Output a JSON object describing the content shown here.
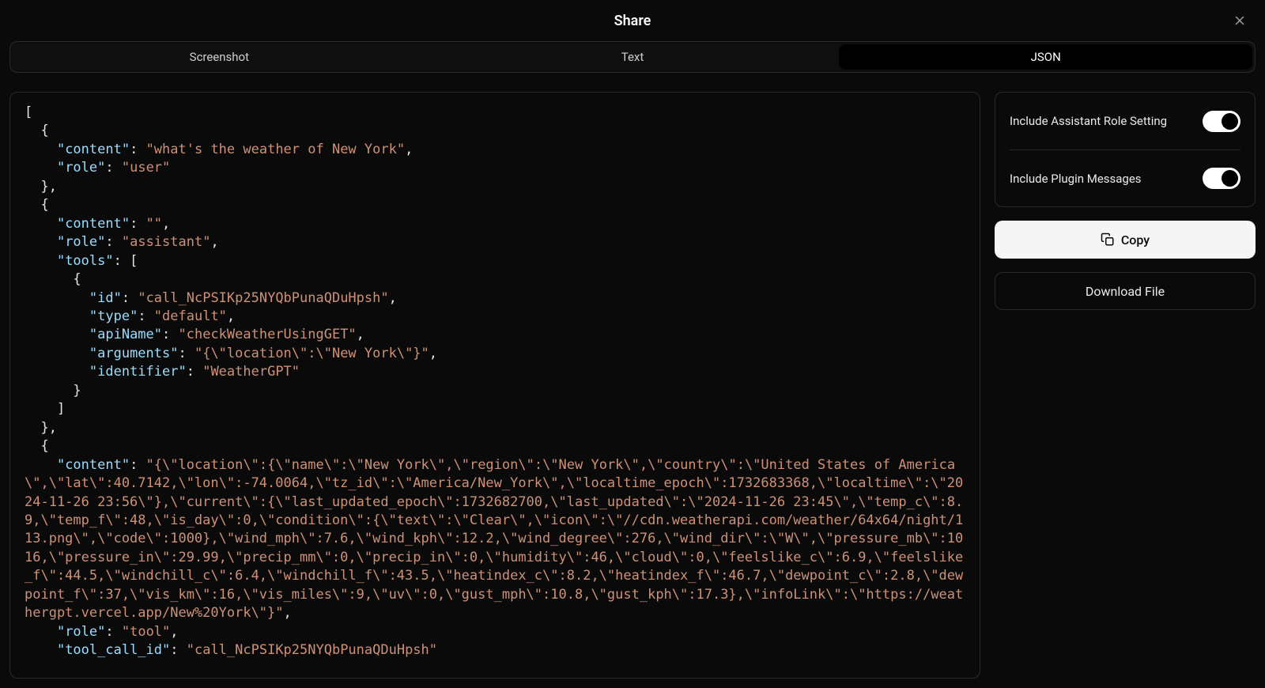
{
  "header": {
    "title": "Share"
  },
  "tabs": [
    {
      "label": "Screenshot",
      "active": false
    },
    {
      "label": "Text",
      "active": false
    },
    {
      "label": "JSON",
      "active": true
    }
  ],
  "options": {
    "assistantRole": {
      "label": "Include Assistant Role Setting",
      "value": true
    },
    "pluginMessages": {
      "label": "Include Plugin Messages",
      "value": true
    }
  },
  "actions": {
    "copy": "Copy",
    "download": "Download File"
  },
  "json_content": [
    {
      "type": "p",
      "text": "["
    },
    {
      "type": "p",
      "text": "  {"
    },
    {
      "type": "kv",
      "indent": "    ",
      "key": "content",
      "valType": "s",
      "val": "what's the weather of New York",
      "comma": true
    },
    {
      "type": "kv",
      "indent": "    ",
      "key": "role",
      "valType": "s",
      "val": "user",
      "comma": false
    },
    {
      "type": "p",
      "text": "  },"
    },
    {
      "type": "p",
      "text": "  {"
    },
    {
      "type": "kv",
      "indent": "    ",
      "key": "content",
      "valType": "s",
      "val": "",
      "comma": true
    },
    {
      "type": "kv",
      "indent": "    ",
      "key": "role",
      "valType": "s",
      "val": "assistant",
      "comma": true
    },
    {
      "type": "karr",
      "indent": "    ",
      "key": "tools"
    },
    {
      "type": "p",
      "text": "      {"
    },
    {
      "type": "kv",
      "indent": "        ",
      "key": "id",
      "valType": "s",
      "val": "call_NcPSIKp25NYQbPunaQDuHpsh",
      "comma": true
    },
    {
      "type": "kv",
      "indent": "        ",
      "key": "type",
      "valType": "s",
      "val": "default",
      "comma": true
    },
    {
      "type": "kv",
      "indent": "        ",
      "key": "apiName",
      "valType": "s",
      "val": "checkWeatherUsingGET",
      "comma": true
    },
    {
      "type": "kv",
      "indent": "        ",
      "key": "arguments",
      "valType": "s",
      "val": "{\\\"location\\\":\\\"New York\\\"}",
      "comma": true
    },
    {
      "type": "kv",
      "indent": "        ",
      "key": "identifier",
      "valType": "s",
      "val": "WeatherGPT",
      "comma": false
    },
    {
      "type": "p",
      "text": "      }"
    },
    {
      "type": "p",
      "text": "    ]"
    },
    {
      "type": "p",
      "text": "  },"
    },
    {
      "type": "p",
      "text": "  {"
    },
    {
      "type": "kv",
      "indent": "    ",
      "key": "content",
      "valType": "s",
      "val": "{\\\"location\\\":{\\\"name\\\":\\\"New York\\\",\\\"region\\\":\\\"New York\\\",\\\"country\\\":\\\"United States of America\\\",\\\"lat\\\":40.7142,\\\"lon\\\":-74.0064,\\\"tz_id\\\":\\\"America/New_York\\\",\\\"localtime_epoch\\\":1732683368,\\\"localtime\\\":\\\"2024-11-26 23:56\\\"},\\\"current\\\":{\\\"last_updated_epoch\\\":1732682700,\\\"last_updated\\\":\\\"2024-11-26 23:45\\\",\\\"temp_c\\\":8.9,\\\"temp_f\\\":48,\\\"is_day\\\":0,\\\"condition\\\":{\\\"text\\\":\\\"Clear\\\",\\\"icon\\\":\\\"//cdn.weatherapi.com/weather/64x64/night/113.png\\\",\\\"code\\\":1000},\\\"wind_mph\\\":7.6,\\\"wind_kph\\\":12.2,\\\"wind_degree\\\":276,\\\"wind_dir\\\":\\\"W\\\",\\\"pressure_mb\\\":1016,\\\"pressure_in\\\":29.99,\\\"precip_mm\\\":0,\\\"precip_in\\\":0,\\\"humidity\\\":46,\\\"cloud\\\":0,\\\"feelslike_c\\\":6.9,\\\"feelslike_f\\\":44.5,\\\"windchill_c\\\":6.4,\\\"windchill_f\\\":43.5,\\\"heatindex_c\\\":8.2,\\\"heatindex_f\\\":46.7,\\\"dewpoint_c\\\":2.8,\\\"dewpoint_f\\\":37,\\\"vis_km\\\":16,\\\"vis_miles\\\":9,\\\"uv\\\":0,\\\"gust_mph\\\":10.8,\\\"gust_kph\\\":17.3},\\\"infoLink\\\":\\\"https://weathergpt.vercel.app/New%20York\\\"}",
      "comma": true
    },
    {
      "type": "kv",
      "indent": "    ",
      "key": "role",
      "valType": "s",
      "val": "tool",
      "comma": true
    },
    {
      "type": "kv",
      "indent": "    ",
      "key": "tool_call_id",
      "valType": "s",
      "val": "call_NcPSIKp25NYQbPunaQDuHpsh",
      "comma": false
    }
  ]
}
